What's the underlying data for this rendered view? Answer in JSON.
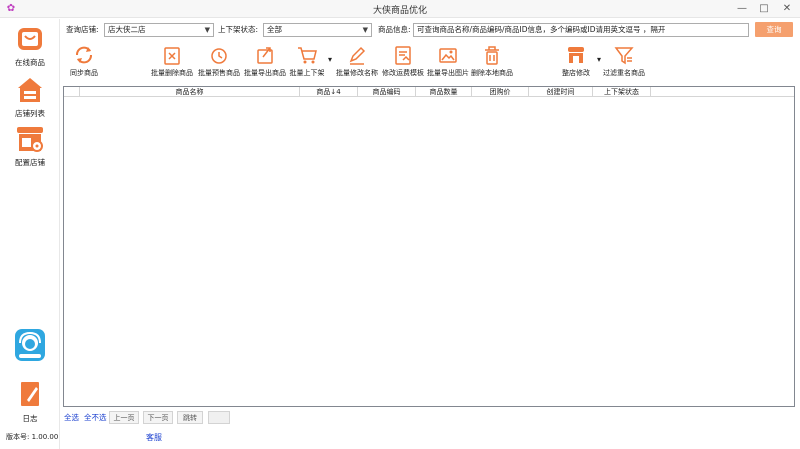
{
  "window": {
    "title": "大侠商品优化",
    "min": "—",
    "max": "□",
    "close": "✕"
  },
  "sidebar": {
    "items": [
      {
        "label": "在线商品",
        "icon": "bag-icon"
      },
      {
        "label": "店铺列表",
        "icon": "store-icon"
      },
      {
        "label": "配置店铺",
        "icon": "store-settings-icon"
      },
      {
        "label": "",
        "icon": "customer-service-icon"
      },
      {
        "label": "日志",
        "icon": "log-icon"
      }
    ]
  },
  "filters": {
    "shop_label": "查询店铺:",
    "shop_value": "店大侠二店",
    "status_label": "上下架状态:",
    "status_value": "全部",
    "info_label": "商品信息:",
    "info_value": "可查询商品名称/商品编码/商品ID信息，多个编码或ID请用英文逗号 ，隔开",
    "query_button": "查询"
  },
  "toolbar": {
    "items": [
      {
        "label": "同步商品",
        "icon": "sync-icon"
      },
      {
        "label": "批量删除商品",
        "icon": "batch-delete-icon"
      },
      {
        "label": "批量预售商品",
        "icon": "presale-icon"
      },
      {
        "label": "批量导出商品",
        "icon": "export-icon"
      },
      {
        "label": "批量上下架",
        "icon": "cart-icon"
      },
      {
        "label": "批量修改名称",
        "icon": "edit-name-icon"
      },
      {
        "label": "修改运费模板",
        "icon": "freight-template-icon"
      },
      {
        "label": "批量导出图片",
        "icon": "export-image-icon"
      },
      {
        "label": "删除本地商品",
        "icon": "trash-icon"
      },
      {
        "label": "整店修改",
        "icon": "shop-edit-icon"
      },
      {
        "label": "过滤重名商品",
        "icon": "filter-icon"
      }
    ]
  },
  "table": {
    "columns": [
      "商品名称",
      "商品↓4",
      "商品编码",
      "商品数量",
      "团购价",
      "创建时间",
      "上下架状态"
    ],
    "rows": []
  },
  "pager": {
    "select_all": "全选",
    "select_none": "全不选",
    "prev": "上一页",
    "next": "下一页",
    "jump": "跳转",
    "page_input": ""
  },
  "footer": {
    "version": "版本号: 1.00.00",
    "service": "客服"
  },
  "colors": {
    "accent": "#ef7a3c",
    "query_button": "#f5a06e",
    "link": "#1a3fcf",
    "service_icon": "#2fa7e0"
  }
}
